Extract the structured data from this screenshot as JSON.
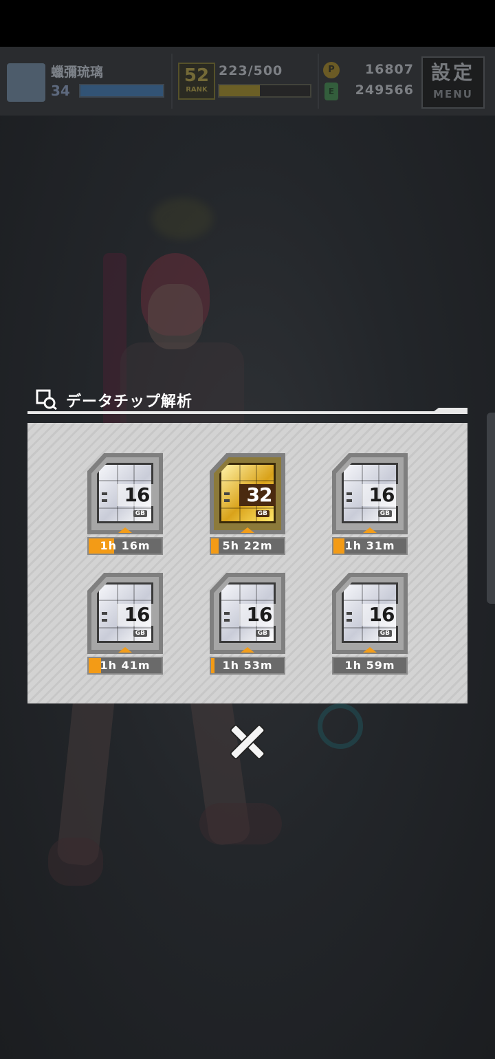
{
  "hud": {
    "player_name": "蠟彌琉璃",
    "level": "34",
    "level_progress": 1.0,
    "rank": "52",
    "rank_label": "RANK",
    "exp": "223/500",
    "exp_progress": 0.45,
    "coins": "16807",
    "gems": "249566",
    "coin_symbol": "P",
    "gem_symbol": "E",
    "menu_kanji": "設定",
    "menu_label": "MENU"
  },
  "dialog": {
    "title": "データチップ解析",
    "chips": [
      {
        "size": "16",
        "unit": "GB",
        "tier": "silver",
        "time": "1h 16m",
        "progress": 0.35
      },
      {
        "size": "32",
        "unit": "GB",
        "tier": "gold",
        "time": "5h 22m",
        "progress": 0.1
      },
      {
        "size": "16",
        "unit": "GB",
        "tier": "silver",
        "time": "1h 31m",
        "progress": 0.15
      },
      {
        "size": "16",
        "unit": "GB",
        "tier": "silver",
        "time": "1h 41m",
        "progress": 0.17
      },
      {
        "size": "16",
        "unit": "GB",
        "tier": "silver",
        "time": "1h 53m",
        "progress": 0.05
      },
      {
        "size": "16",
        "unit": "GB",
        "tier": "silver",
        "time": "1h 59m",
        "progress": 0.0
      }
    ]
  },
  "icons": {
    "title": "chip-search-icon",
    "close": "close-icon"
  },
  "colors": {
    "accent": "#f39b16",
    "panel": "#d3d3d3",
    "background": "#1d1f22"
  }
}
